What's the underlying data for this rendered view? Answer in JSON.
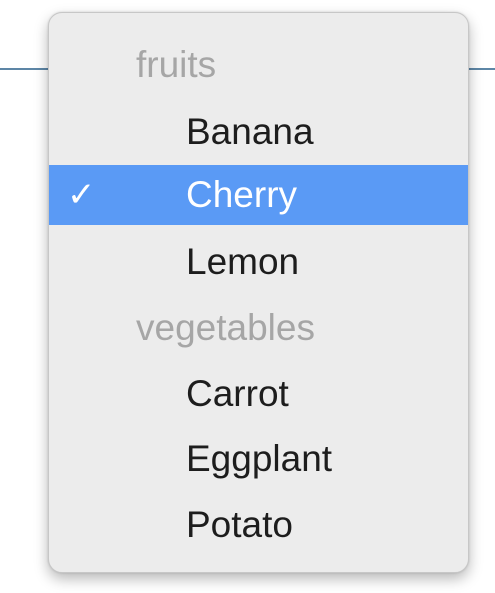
{
  "menu": {
    "groups": [
      {
        "label": "fruits",
        "items": [
          {
            "label": "Banana",
            "selected": false
          },
          {
            "label": "Cherry",
            "selected": true
          },
          {
            "label": "Lemon",
            "selected": false
          }
        ]
      },
      {
        "label": "vegetables",
        "items": [
          {
            "label": "Carrot",
            "selected": false
          },
          {
            "label": "Eggplant",
            "selected": false
          },
          {
            "label": "Potato",
            "selected": false
          }
        ]
      }
    ],
    "checkmark_glyph": "✓",
    "selection_color": "#5a9af5"
  }
}
